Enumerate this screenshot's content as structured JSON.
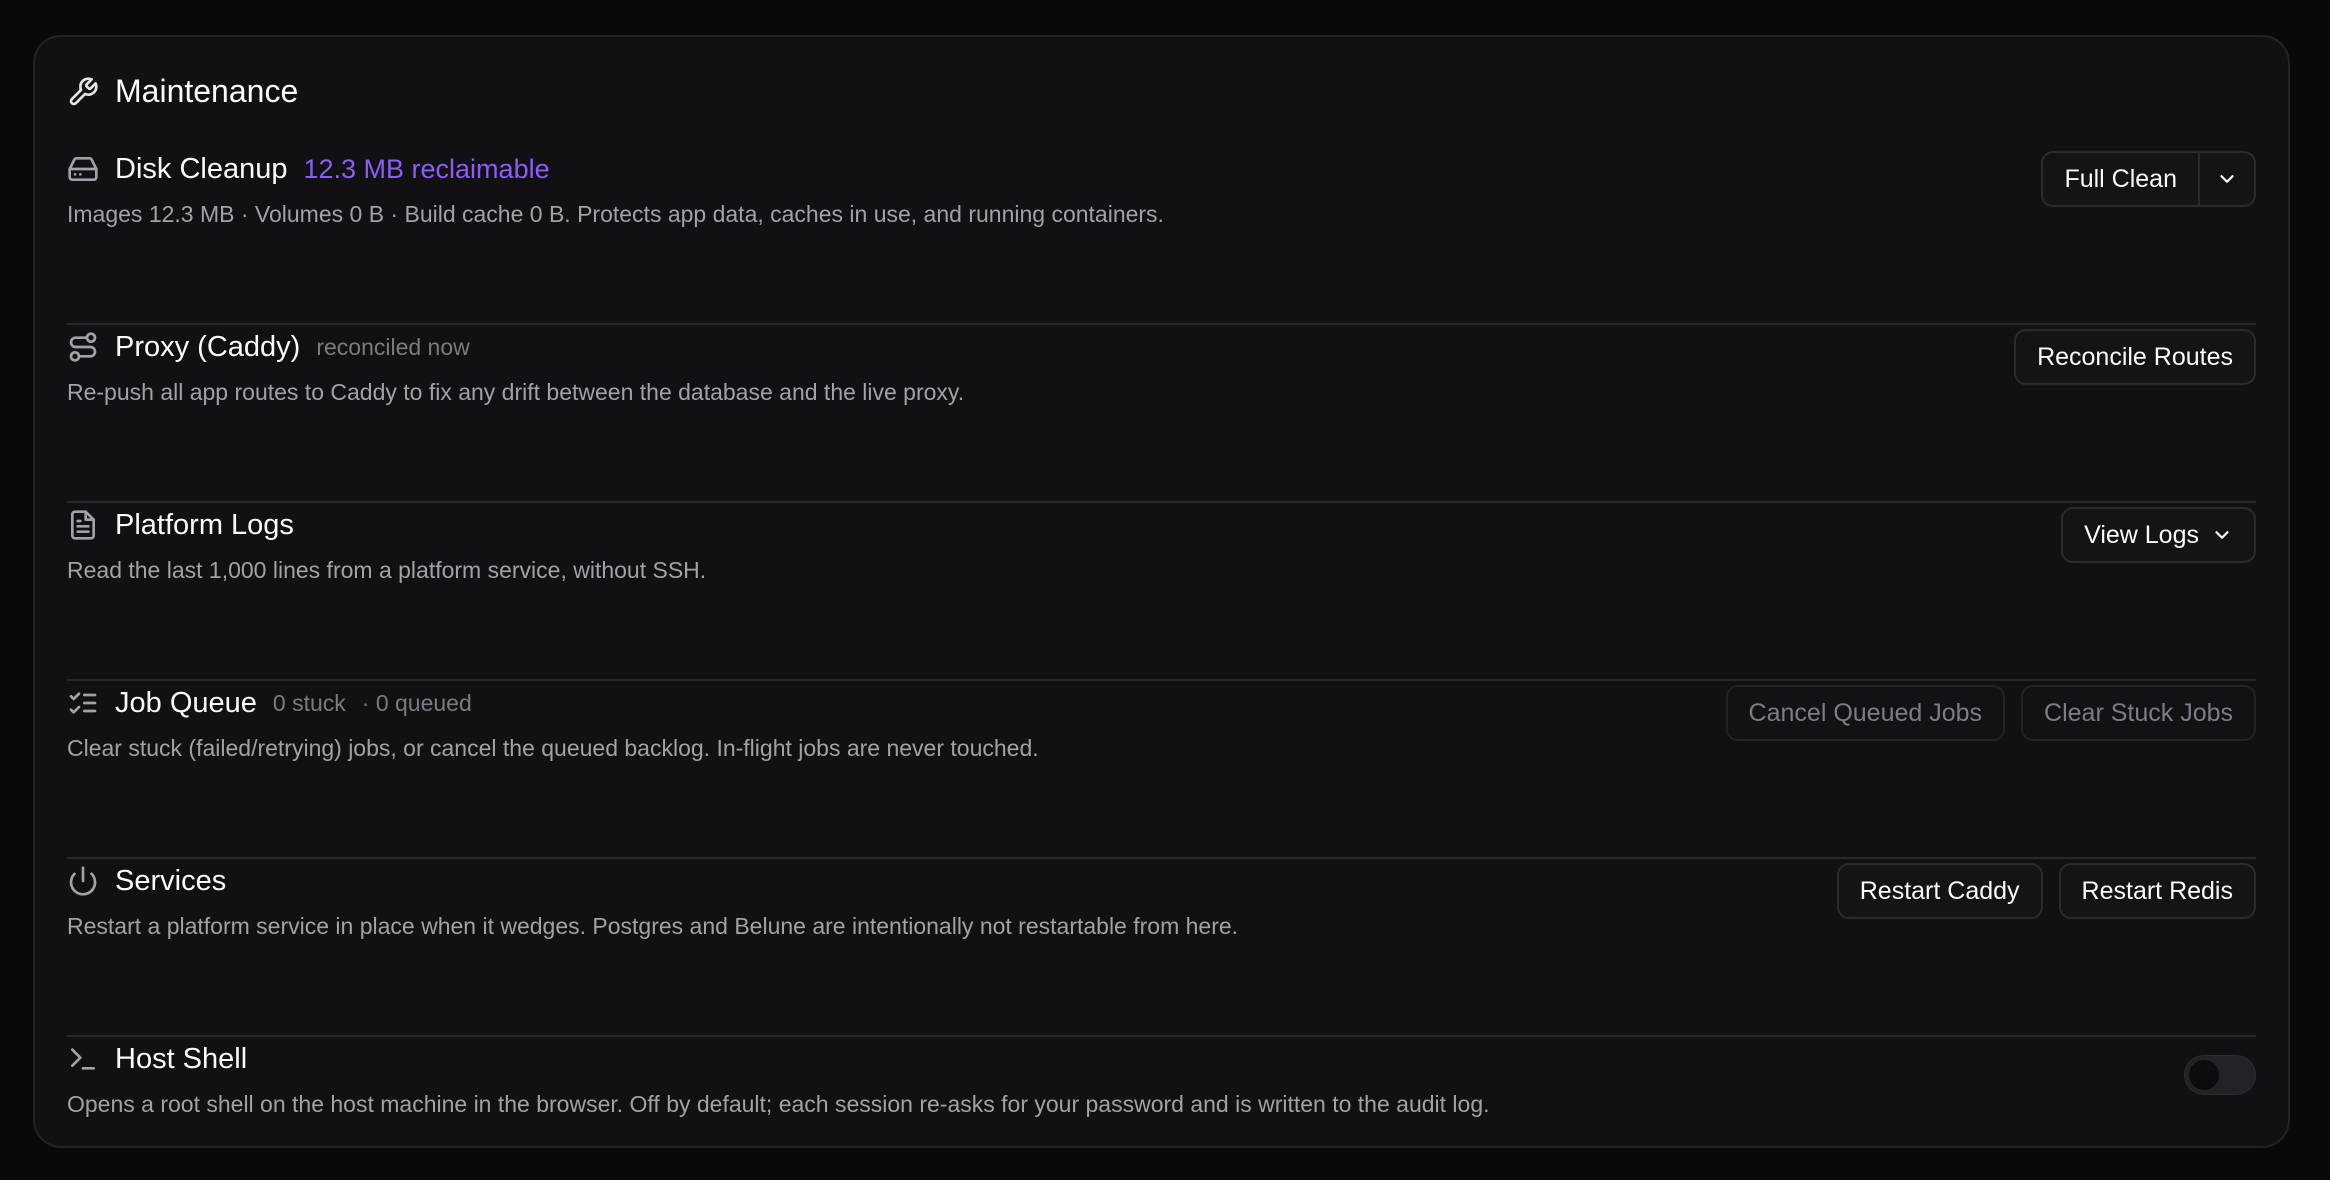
{
  "card": {
    "title": "Maintenance",
    "icon": "wrench-icon"
  },
  "disk": {
    "title": "Disk Cleanup",
    "reclaimable": "12.3 MB reclaimable",
    "desc": "Images 12.3 MB · Volumes 0 B · Build cache 0 B. Protects app data, caches in use, and running containers.",
    "button": "Full Clean"
  },
  "proxy": {
    "title": "Proxy (Caddy)",
    "status": "reconciled now",
    "desc": "Re-push all app routes to Caddy to fix any drift between the database and the live proxy.",
    "button": "Reconcile Routes"
  },
  "logs": {
    "title": "Platform Logs",
    "desc": "Read the last 1,000 lines from a platform service, without SSH.",
    "button": "View Logs"
  },
  "jobs": {
    "title": "Job Queue",
    "stuck": "0 stuck",
    "queued": "· 0 queued",
    "desc": "Clear stuck (failed/retrying) jobs, or cancel the queued backlog. In-flight jobs are never touched.",
    "cancel_button": "Cancel Queued Jobs",
    "clear_button": "Clear Stuck Jobs"
  },
  "services": {
    "title": "Services",
    "desc": "Restart a platform service in place when it wedges. Postgres and Belune are intentionally not restartable from here.",
    "restart_caddy": "Restart Caddy",
    "restart_redis": "Restart Redis"
  },
  "shell": {
    "title": "Host Shell",
    "desc": "Opens a root shell on the host machine in the browser. Off by default; each session re-asks for your password and is written to the audit log.",
    "enabled": false
  },
  "colors": {
    "accent": "#8b5cf6",
    "background": "#09090b",
    "card": "#111113"
  }
}
